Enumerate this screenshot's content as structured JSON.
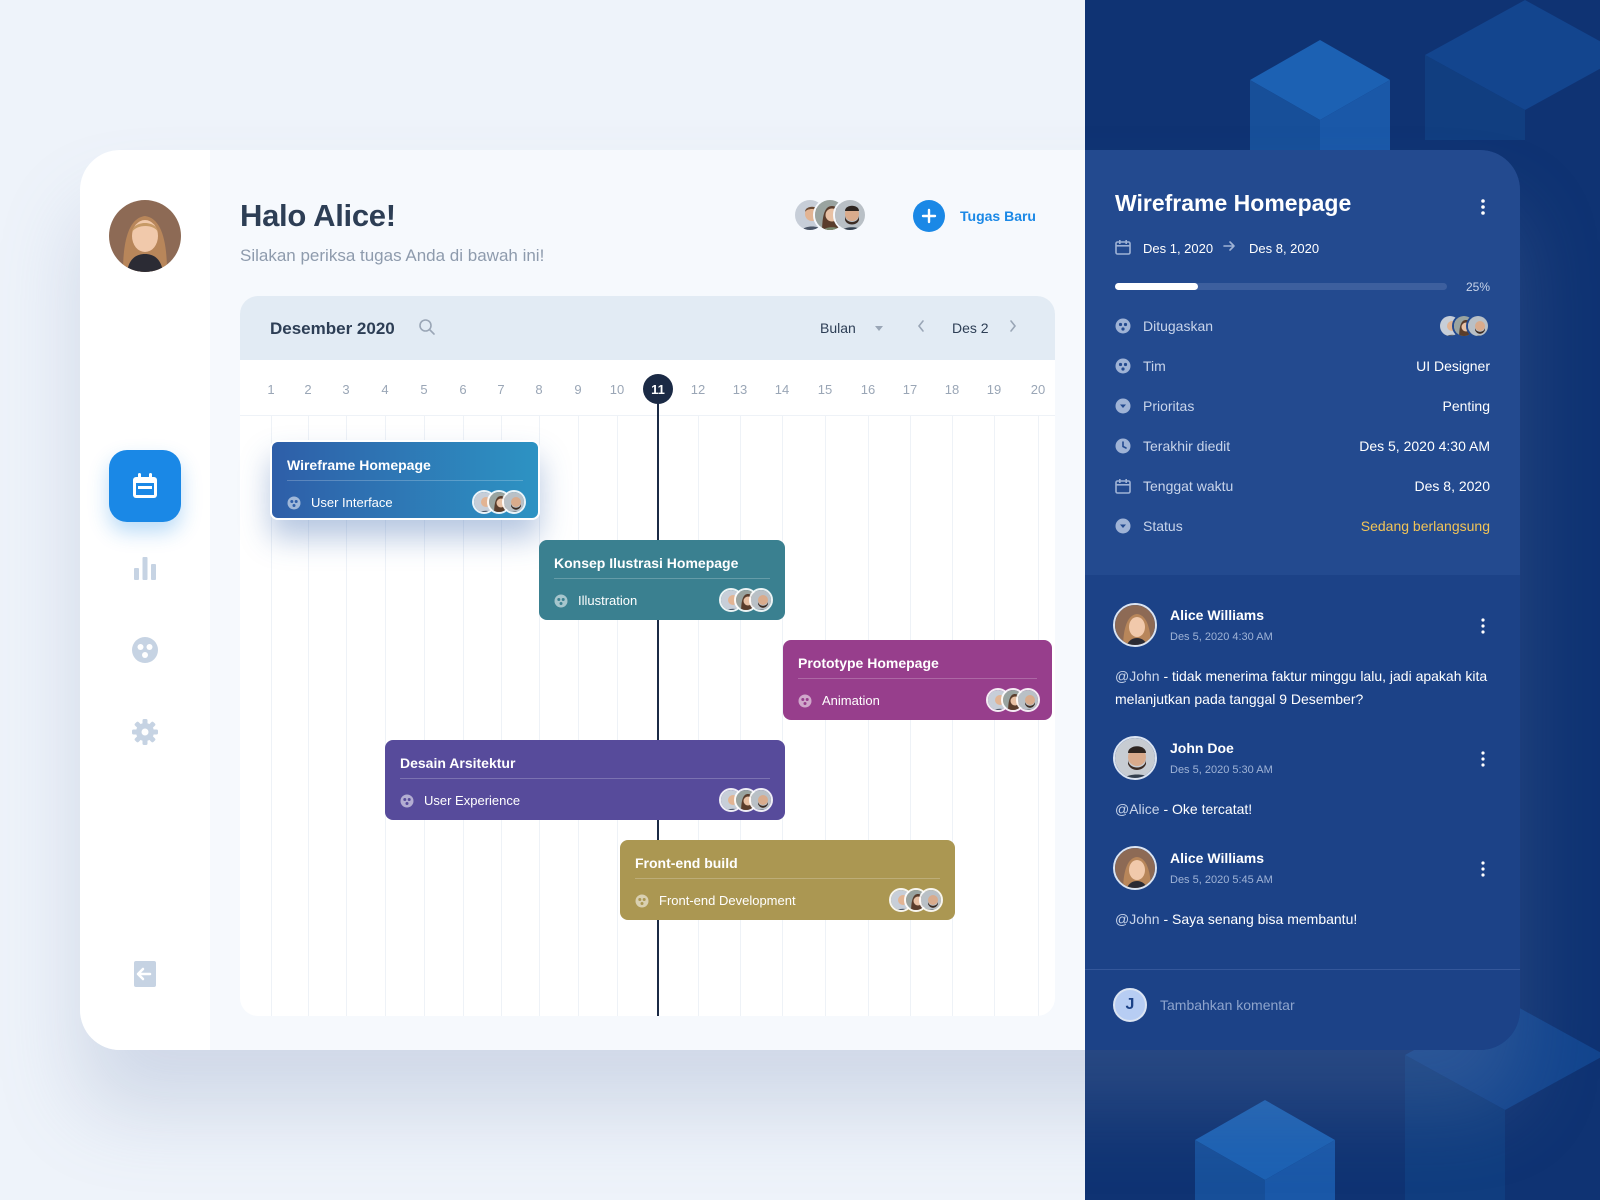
{
  "colors": {
    "accent": "#1a88e6",
    "dark_panel": "#1c4287",
    "status": "#f2c457",
    "today": "#1b2a45"
  },
  "sidebar": {
    "user_avatar": "alice-avatar",
    "nav": [
      {
        "name": "calendar",
        "icon": "calendar-icon",
        "active": true
      },
      {
        "name": "stats",
        "icon": "bar-chart-icon",
        "active": false
      },
      {
        "name": "team",
        "icon": "team-icon",
        "active": false
      },
      {
        "name": "settings",
        "icon": "gear-icon",
        "active": false
      }
    ],
    "logout_icon": "logout-icon"
  },
  "header": {
    "greeting": "Halo Alice!",
    "subtitle": "Silakan periksa tugas Anda di bawah ini!",
    "add_label": "Tugas Baru"
  },
  "calendar": {
    "month": "Desember 2020",
    "view": "Bulan",
    "range": "Des 2",
    "days": [
      "1",
      "2",
      "3",
      "4",
      "5",
      "6",
      "7",
      "8",
      "9",
      "10",
      "11",
      "12",
      "13",
      "14",
      "15",
      "16",
      "17",
      "18",
      "19",
      "20"
    ],
    "today": "11"
  },
  "tasks": [
    {
      "title": "Wireframe Homepage",
      "category": "User Interface",
      "color": "#2f6fb3"
    },
    {
      "title": "Konsep Ilustrasi Homepage",
      "category": "Illustration",
      "color": "#3a8090"
    },
    {
      "title": "Prototype Homepage",
      "category": "Animation",
      "color": "#973e8c"
    },
    {
      "title": "Desain Arsitektur",
      "category": "User Experience",
      "color": "#574b9b"
    },
    {
      "title": "Front-end build",
      "category": "Front-end Development",
      "color": "#ab9752"
    }
  ],
  "detail": {
    "title": "Wireframe Homepage",
    "start": "Des 1, 2020",
    "end": "Des 8, 2020",
    "progress": 25,
    "progress_label": "25%",
    "props": [
      {
        "label": "Ditugaskan",
        "value": "",
        "icon": "assign-icon"
      },
      {
        "label": "Tim",
        "value": "UI Designer",
        "icon": "team-icon"
      },
      {
        "label": "Prioritas",
        "value": "Penting",
        "icon": "priority-icon"
      },
      {
        "label": "Terakhir diedit",
        "value": "Des 5, 2020  4:30 AM",
        "icon": "clock-icon"
      },
      {
        "label": "Tenggat waktu",
        "value": "Des 8, 2020",
        "icon": "calendar-icon"
      },
      {
        "label": "Status",
        "value": "Sedang berlangsung",
        "icon": "status-icon"
      }
    ]
  },
  "comments": [
    {
      "name": "Alice Williams",
      "time": "Des 5, 2020 4:30 AM",
      "mention": "@John",
      "text": " - tidak menerima faktur minggu lalu, jadi apakah kita melanjutkan pada tanggal 9 Desember?"
    },
    {
      "name": "John Doe",
      "time": "Des 5, 2020 5:30 AM",
      "mention": "@Alice",
      "text": " - Oke tercatat!"
    },
    {
      "name": "Alice Williams",
      "time": "Des 5, 2020 5:45 AM",
      "mention": "@John",
      "text": " - Saya senang bisa membantu!"
    }
  ],
  "comment_input": {
    "avatar_letter": "J",
    "placeholder": "Tambahkan komentar"
  }
}
